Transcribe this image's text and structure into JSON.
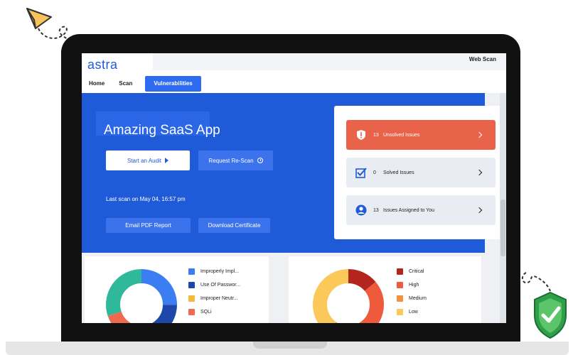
{
  "app": {
    "logo": "astra",
    "top_right": "Web Scan"
  },
  "nav": {
    "items": [
      "Home",
      "Scan",
      "Vulnerabilities"
    ],
    "active": "Vulnerabilities"
  },
  "hero": {
    "title": "Amazing SaaS App",
    "start_audit": "Start an Audit",
    "request_rescan": "Request Re-Scan",
    "last_scan": "Last scan on May 04, 16:57 pm",
    "email_report": "Email PDF Report",
    "download_certificate": "Download Certificate"
  },
  "issues": [
    {
      "count": "13",
      "label": "Unsolved Issues",
      "icon": "alert-shield-icon"
    },
    {
      "count": "0",
      "label": "Solved Issues",
      "icon": "checkbox-icon"
    },
    {
      "count": "13",
      "label": "Issues Assigned to You",
      "icon": "user-circle-icon"
    }
  ],
  "vuln_types_legend": [
    {
      "label": "Improperly Impl...",
      "color": "#3b7df2"
    },
    {
      "label": "Use Of Passwor...",
      "color": "#1d47a8"
    },
    {
      "label": "Improper Neutr...",
      "color": "#f5b942"
    },
    {
      "label": "SQLi",
      "color": "#ef6a4f"
    }
  ],
  "severity_legend": [
    {
      "label": "Critical",
      "color": "#b3261e"
    },
    {
      "label": "High",
      "color": "#ef5a3c"
    },
    {
      "label": "Medium",
      "color": "#f5913e"
    },
    {
      "label": "Low",
      "color": "#fbc85a"
    }
  ],
  "colors": {
    "brand": "#1f5bd8",
    "alert": "#e9634a"
  }
}
